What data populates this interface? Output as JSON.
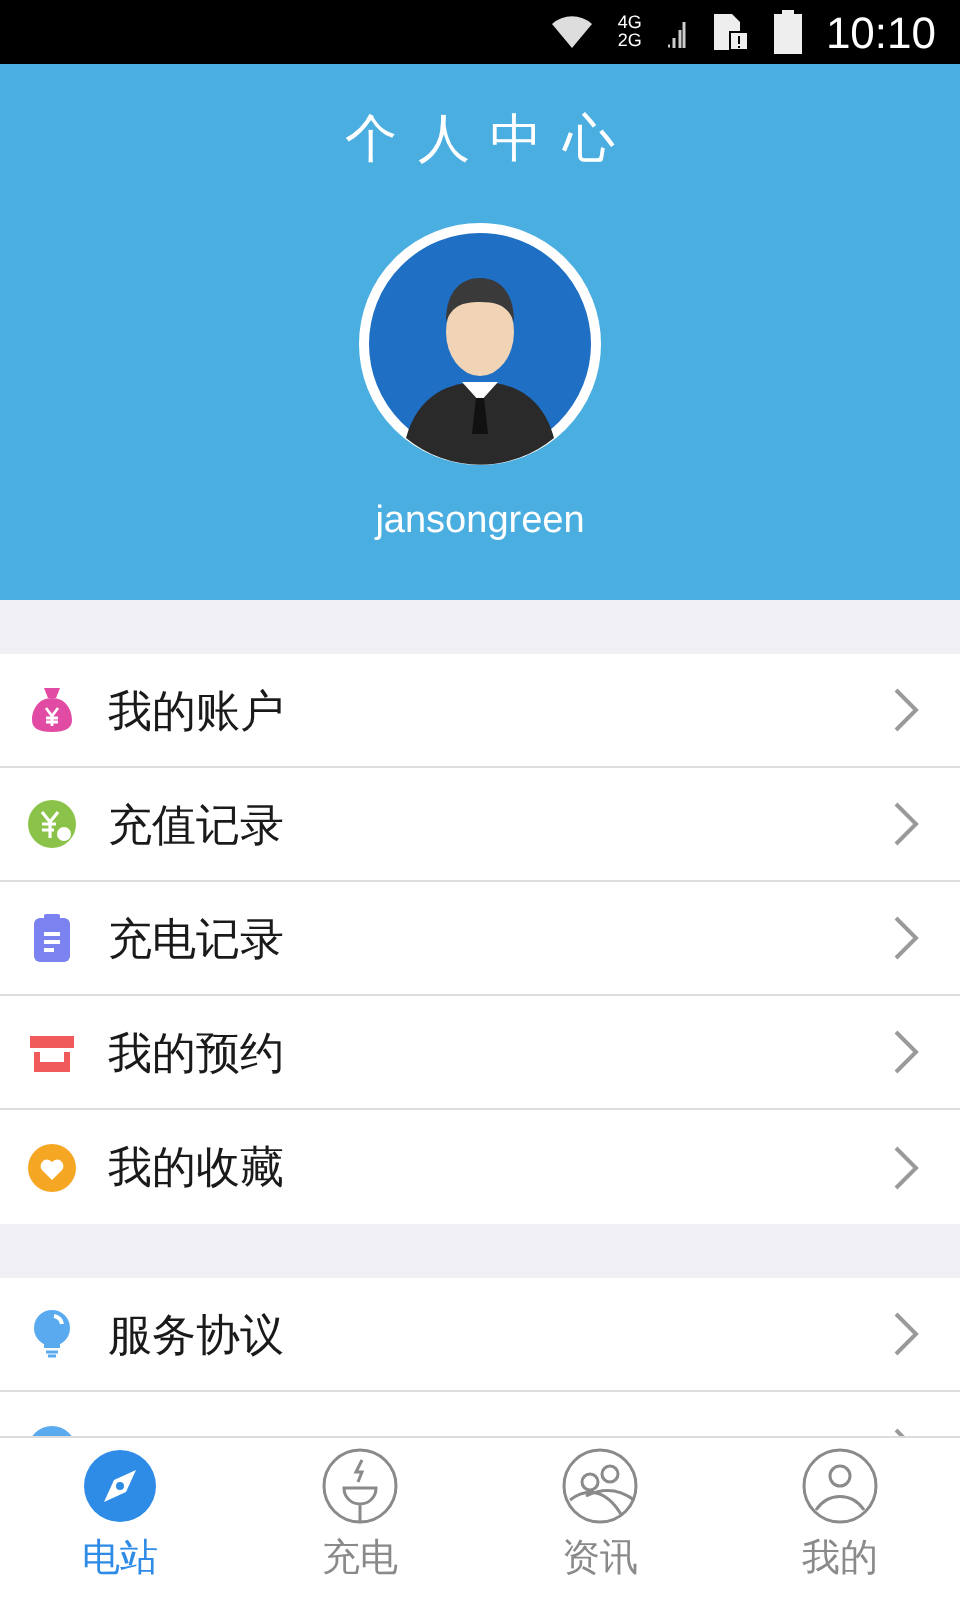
{
  "status_bar": {
    "network_top": "4G",
    "network_bottom": "2G",
    "time": "10:10"
  },
  "header": {
    "title": "个人中心",
    "username": "jansongreen"
  },
  "menu_groups": [
    [
      {
        "kind": "account",
        "label": "我的账户"
      },
      {
        "kind": "recharge",
        "label": "充值记录"
      },
      {
        "kind": "charging",
        "label": "充电记录"
      },
      {
        "kind": "booking",
        "label": "我的预约"
      },
      {
        "kind": "favorites",
        "label": "我的收藏"
      }
    ],
    [
      {
        "kind": "service",
        "label": "服务协议"
      },
      {
        "kind": "version"
      }
    ]
  ],
  "tabs": [
    {
      "kind": "station",
      "label": "电站",
      "selected": true
    },
    {
      "kind": "charge",
      "label": "充电",
      "selected": false
    },
    {
      "kind": "news",
      "label": "资讯",
      "selected": false
    },
    {
      "kind": "mine",
      "label": "我的",
      "selected": false
    }
  ]
}
